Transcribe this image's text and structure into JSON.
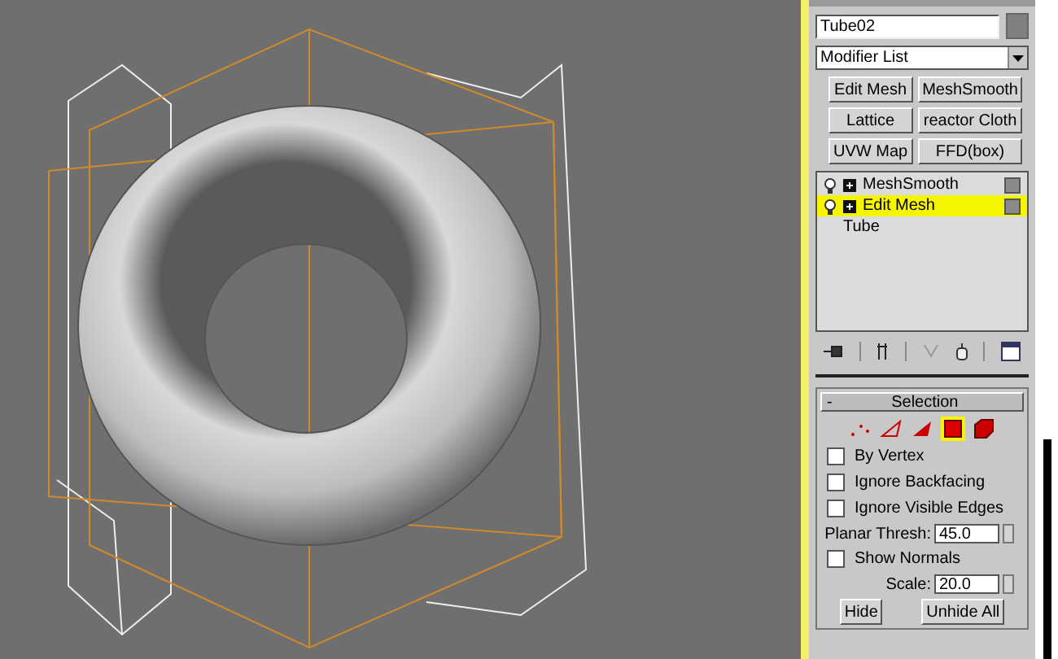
{
  "object_name": {
    "value": "Tube02"
  },
  "modifier_list": {
    "label": "Modifier List"
  },
  "modifier_buttons": [
    "Edit Mesh",
    "MeshSmooth",
    "Lattice",
    "reactor Cloth",
    "UVW Map",
    "FFD(box)"
  ],
  "stack": [
    {
      "kind": "modifier",
      "label": "MeshSmooth",
      "selected": false
    },
    {
      "kind": "modifier",
      "label": "Edit Mesh",
      "selected": true
    },
    {
      "kind": "base",
      "label": "Tube",
      "selected": false
    }
  ],
  "rollout": {
    "title": "Selection",
    "toggle": "-",
    "levels": [
      {
        "kind": "vertex",
        "selected": false
      },
      {
        "kind": "edge",
        "selected": false
      },
      {
        "kind": "face",
        "selected": false
      },
      {
        "kind": "polygon",
        "selected": true
      },
      {
        "kind": "element",
        "selected": false
      }
    ],
    "options": [
      {
        "label": "By Vertex",
        "checked": false
      },
      {
        "label": "Ignore Backfacing",
        "checked": false
      },
      {
        "label": "Ignore Visible Edges",
        "checked": false
      }
    ],
    "planar_thresh": {
      "label": "Planar Thresh:",
      "value": "45.0"
    },
    "show_normals": {
      "label": "Show Normals",
      "checked": false
    },
    "scale": {
      "label": "Scale:",
      "value": "20.0"
    },
    "buttons": [
      "Hide",
      "Unhide All"
    ]
  }
}
